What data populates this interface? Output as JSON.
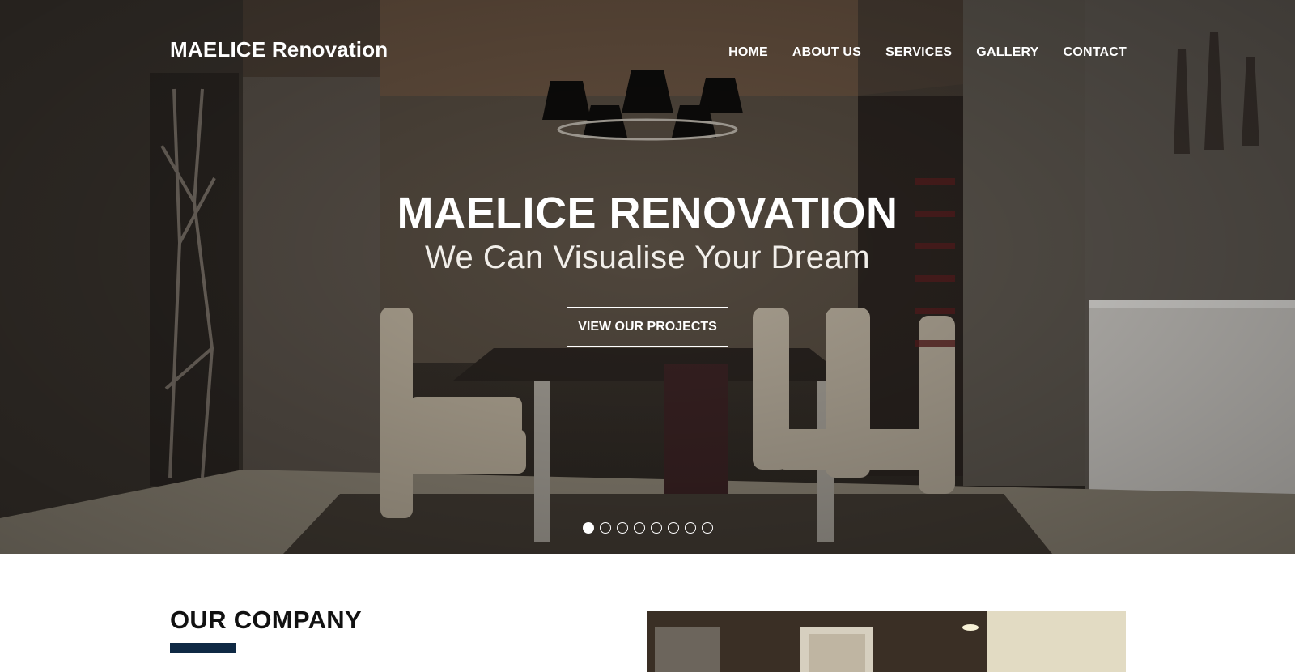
{
  "header": {
    "brand": "MAELICE Renovation",
    "nav": [
      {
        "label": "HOME"
      },
      {
        "label": "ABOUT US"
      },
      {
        "label": "SERVICES"
      },
      {
        "label": "GALLERY"
      },
      {
        "label": "CONTACT"
      }
    ]
  },
  "hero": {
    "title": "MAELICE RENOVATION",
    "subtitle": "We Can Visualise Your Dream",
    "cta_label": "VIEW OUR PROJECTS",
    "slides": {
      "total": 8,
      "active": 1
    }
  },
  "company": {
    "heading": "OUR COMPANY",
    "accent_color": "#0f2944"
  },
  "icons": [
    "slider-dot-icon"
  ]
}
